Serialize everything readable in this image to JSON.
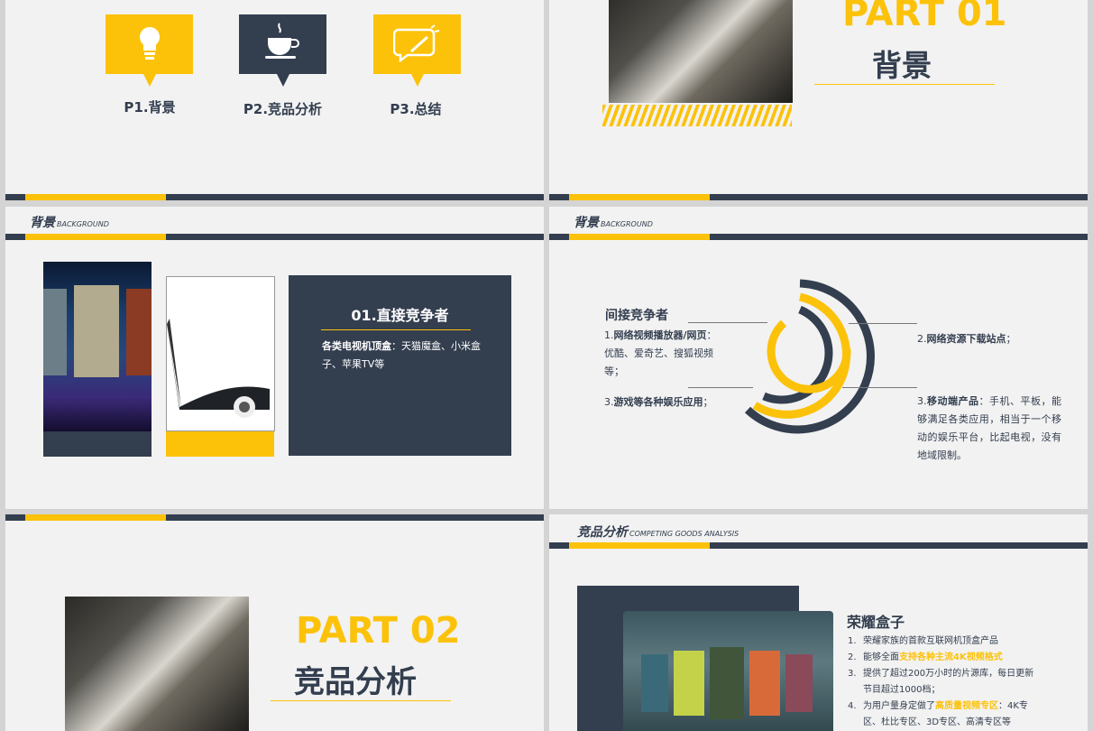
{
  "colors": {
    "navy": "#333e4f",
    "yellow": "#fcc20a",
    "bg": "#f2f2f2"
  },
  "slide1": {
    "nav": [
      {
        "label": "P1.背景",
        "icon": "lightbulb-icon"
      },
      {
        "label": "P2.竞品分析",
        "icon": "coffee-cup-icon"
      },
      {
        "label": "P3.总结",
        "icon": "chat-bubble-icon"
      }
    ]
  },
  "slide2": {
    "part": "PART 01",
    "title": "背景"
  },
  "slide3": {
    "header": "背景",
    "header_en": "BACKGROUND",
    "box_title": "01.直接竞争者",
    "box_bold": "各类电视机顶盒",
    "box_rest": "：天猫魔盒、小米盒子、苹果TV等"
  },
  "slide4": {
    "header": "背景",
    "header_en": "BACKGROUND",
    "title": "间接竞争者",
    "item1_num": "1.",
    "item1_bold": "网络视频播放器/网页",
    "item1_rest": "：优酷、爱奇艺、搜狐视频等；",
    "item2_num": "2.",
    "item2_bold": "网络资源下载站点",
    "item2_rest": "；",
    "item3_num": "3.",
    "item3_bold": "游戏等各种娱乐应用",
    "item3_rest": "；",
    "item4_num": "3.",
    "item4_bold": "移动端产品",
    "item4_rest": "：手机、平板，能够满足各类应用，相当于一个移动的娱乐平台，比起电视，没有地域限制。"
  },
  "slide5": {
    "part": "PART 02",
    "title": "竞品分析"
  },
  "slide6": {
    "header": "竞品分析",
    "header_en": "COMPETING GOODS ANALYSIS",
    "product": "荣耀盒子",
    "points": [
      {
        "num": "1.",
        "pre": "荣耀家族的首款互联网机顶盒产品",
        "hl": "",
        "post": ""
      },
      {
        "num": "2.",
        "pre": "能够全面",
        "hl": "支持各种主流4K视频格式",
        "post": ""
      },
      {
        "num": "3.",
        "pre": "提供了超过200万小时的片源库，每日更新节目超过1000档；",
        "hl": "",
        "post": ""
      },
      {
        "num": "4.",
        "pre": "为用户量身定做了",
        "hl": "高质量视频专区",
        "post": "：4K专区、杜比专区、3D专区、高清专区等"
      }
    ]
  }
}
